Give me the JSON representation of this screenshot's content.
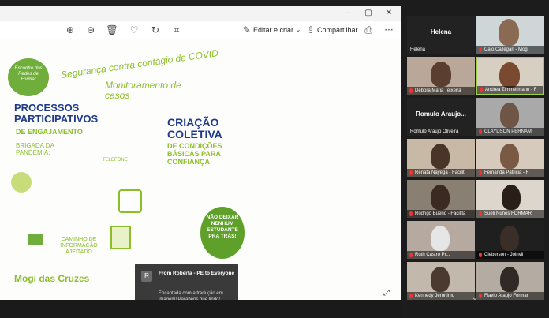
{
  "toolbar": {
    "zoom_in": "zoom-in",
    "zoom_out": "zoom-out",
    "delete": "delete",
    "favorite": "favorite",
    "rotate": "rotate",
    "crop": "crop",
    "edit_label": "Editar e criar",
    "share_label": "Compartilhar",
    "more": "···"
  },
  "artwork": {
    "stamp": "Encontro dos Redes de Formar",
    "headline": "Segurança contra contágio de COVID",
    "monitor": "Monitoramento de casos",
    "processos_title": "PROCESSOS PARTICIPATIVOS",
    "processos_sub": "DE ENGAJAMENTO",
    "brigada": "BRIGADA DA PANDEMIA:",
    "telefone": "TELEFONE",
    "criacao": "CRIAÇÃO COLETIVA",
    "criacao_sub": "DE CONDIÇÕES BÁSICAS PARA CONFIANÇA",
    "slogan": "NÃO DEIXAR NENHUM ESTUDANTE PRA TRÁS!",
    "caminho": "CAMINHO DE INFORMAÇÃO AJEITADO",
    "cidade": "Mogi das Cruzes"
  },
  "toast": {
    "avatar": "R",
    "from": "From Roberta - PE to Everyone",
    "message": "Encantada com a tradução em imagem! Parabéns que lindo!"
  },
  "gallery": {
    "tiles": [
      {
        "name": "Helena",
        "center": "Helena"
      },
      {
        "name": "Caio Callegari - Mogi"
      },
      {
        "name": "Débora Maria Teixeira"
      },
      {
        "name": "Andrea Zimmermann - F"
      },
      {
        "name": "Romulo Araujo Oliveira",
        "center": "Romulo Araujo..."
      },
      {
        "name": "CLAYDSON PERNAM"
      },
      {
        "name": "Renata Nayega - Facilit"
      },
      {
        "name": "Fernanda Patricia - F"
      },
      {
        "name": "Rodrigo Bueno - Facilita"
      },
      {
        "name": "Suéli Nunes FORMAR"
      },
      {
        "name": "Ruth Castro Pr..."
      },
      {
        "name": "Cleberson - Joinvil"
      },
      {
        "name": "Kennedy Jerônimo"
      },
      {
        "name": "Flavio Araujo Formar"
      }
    ]
  }
}
